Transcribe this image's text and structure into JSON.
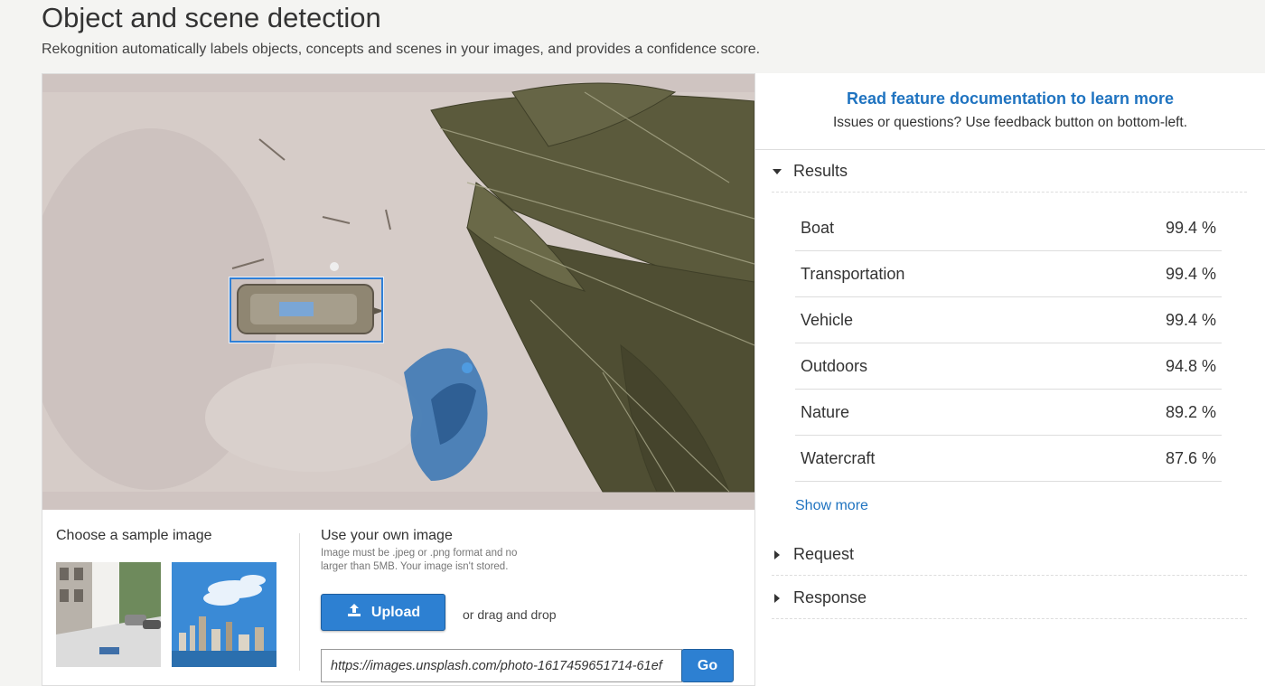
{
  "header": {
    "title": "Object and scene detection",
    "subtitle": "Rekognition automatically labels objects, concepts and scenes in your images, and provides a confidence score."
  },
  "left": {
    "sample_title": "Choose a sample image",
    "own_title": "Use your own image",
    "own_note": "Image must be .jpeg or .png format and no larger than 5MB. Your image isn't stored.",
    "upload_label": "Upload",
    "drag_text": "or drag and drop",
    "url_value": "https://images.unsplash.com/photo-1617459651714-61ef",
    "go_label": "Go"
  },
  "right": {
    "doc_link": "Read feature documentation to learn more",
    "doc_help": "Issues or questions? Use feedback button on bottom-left.",
    "results_label": "Results",
    "request_label": "Request",
    "response_label": "Response",
    "show_more": "Show more",
    "results": [
      {
        "label": "Boat",
        "confidence": "99.4 %"
      },
      {
        "label": "Transportation",
        "confidence": "99.4 %"
      },
      {
        "label": "Vehicle",
        "confidence": "99.4 %"
      },
      {
        "label": "Outdoors",
        "confidence": "94.8 %"
      },
      {
        "label": "Nature",
        "confidence": "89.2 %"
      },
      {
        "label": "Watercraft",
        "confidence": "87.6 %"
      }
    ]
  },
  "colors": {
    "accent": "#2d80d2",
    "link": "#1f73c0",
    "bbox": "#2f7fd6"
  }
}
